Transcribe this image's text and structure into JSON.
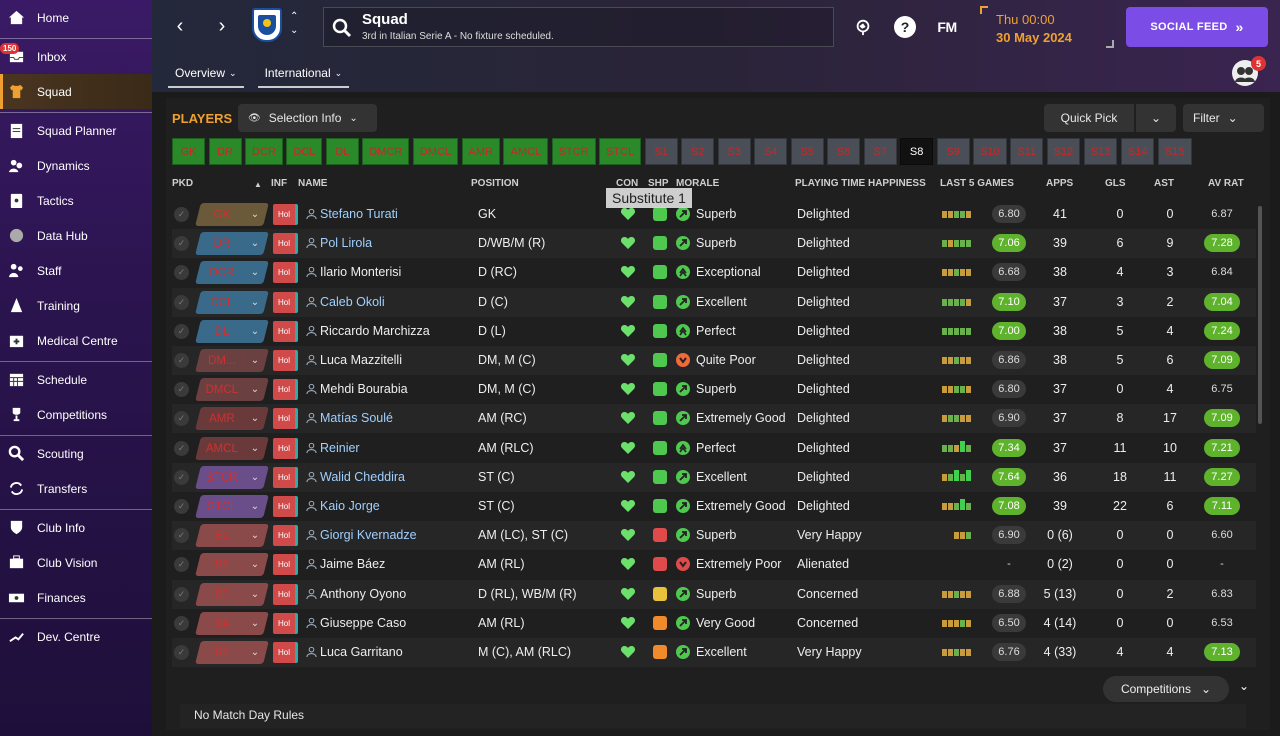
{
  "sidebar": {
    "items": [
      {
        "label": "Home",
        "icon": "home-icon"
      },
      {
        "label": "Inbox",
        "icon": "inbox-icon",
        "badge": "150"
      },
      {
        "label": "Squad",
        "icon": "shirt-icon",
        "active": true
      },
      {
        "label": "Squad Planner",
        "icon": "clipboard-icon"
      },
      {
        "label": "Dynamics",
        "icon": "people-icon"
      },
      {
        "label": "Tactics",
        "icon": "tactics-board-icon"
      },
      {
        "label": "Data Hub",
        "icon": "data-hub-icon"
      },
      {
        "label": "Staff",
        "icon": "staff-icon"
      },
      {
        "label": "Training",
        "icon": "training-cone-icon"
      },
      {
        "label": "Medical Centre",
        "icon": "medical-icon"
      },
      {
        "label": "Schedule",
        "icon": "calendar-icon"
      },
      {
        "label": "Competitions",
        "icon": "trophy-icon"
      },
      {
        "label": "Scouting",
        "icon": "magnifier-icon"
      },
      {
        "label": "Transfers",
        "icon": "transfer-arrows-icon"
      },
      {
        "label": "Club Info",
        "icon": "shield-icon"
      },
      {
        "label": "Club Vision",
        "icon": "briefcase-icon"
      },
      {
        "label": "Finances",
        "icon": "money-icon"
      },
      {
        "label": "Dev. Centre",
        "icon": "growth-icon"
      }
    ]
  },
  "header": {
    "title": "Squad",
    "subtitle": "3rd in Italian Serie A - No fixture scheduled.",
    "fm_label": "FM",
    "help_label": "?",
    "time": "Thu 00:00",
    "date": "30 May 2024",
    "social_feed": "SOCIAL FEED",
    "social_chevron": "»",
    "avatar_badge": "5",
    "tabs": [
      {
        "label": "Overview"
      },
      {
        "label": "International"
      }
    ]
  },
  "panel": {
    "title": "PLAYERS",
    "selection_info": "Selection Info",
    "quick_pick": "Quick Pick",
    "filter": "Filter",
    "tooltip": "Substitute 1",
    "competitions": "Competitions",
    "no_match_rules": "No Match Day Rules"
  },
  "selection_slots": [
    {
      "label": "GK",
      "state": "filled"
    },
    {
      "label": "DR",
      "state": "filled"
    },
    {
      "label": "DCR",
      "state": "filled"
    },
    {
      "label": "DCL",
      "state": "filled"
    },
    {
      "label": "DL",
      "state": "filled"
    },
    {
      "label": "DMCR",
      "state": "filled"
    },
    {
      "label": "DMCL",
      "state": "filled"
    },
    {
      "label": "AMR",
      "state": "filled"
    },
    {
      "label": "AMCL",
      "state": "filled"
    },
    {
      "label": "STCR",
      "state": "filled"
    },
    {
      "label": "STCL",
      "state": "filled"
    },
    {
      "label": "S1",
      "state": "empty"
    },
    {
      "label": "S2",
      "state": "empty"
    },
    {
      "label": "S3",
      "state": "empty"
    },
    {
      "label": "S4",
      "state": "empty"
    },
    {
      "label": "S5",
      "state": "empty"
    },
    {
      "label": "S6",
      "state": "empty"
    },
    {
      "label": "S7",
      "state": "empty"
    },
    {
      "label": "S8",
      "state": "current"
    },
    {
      "label": "S9",
      "state": "empty"
    },
    {
      "label": "S10",
      "state": "empty"
    },
    {
      "label": "S11",
      "state": "empty"
    },
    {
      "label": "S12",
      "state": "empty"
    },
    {
      "label": "S13",
      "state": "empty"
    },
    {
      "label": "S14",
      "state": "empty"
    },
    {
      "label": "S15",
      "state": "empty"
    }
  ],
  "table": {
    "headers": {
      "pkd": "PKD",
      "sort": "▲",
      "inf": "INF",
      "name": "NAME",
      "position": "POSITION",
      "con": "CON",
      "shp": "SHP",
      "morale": "MORALE",
      "pth": "PLAYING TIME HAPPINESS",
      "last5": "LAST 5 GAMES",
      "apps": "APPS",
      "gls": "GLS",
      "ast": "AST",
      "avrat": "AV RAT"
    },
    "rows": [
      {
        "pos": "GK",
        "inf": "Hol",
        "name": "Stefano Turati",
        "link": true,
        "position": "GK",
        "morale": "Superb",
        "mor": "up",
        "pth": "Delighted",
        "l5": "6.80",
        "l5g": false,
        "bars": "ccggc",
        "apps": "41",
        "gls": "0",
        "ast": "0",
        "avr": "6.87",
        "avrg": false,
        "shp": "g"
      },
      {
        "pos": "DR",
        "inf": "Hol",
        "name": "Pol Lirola",
        "link": true,
        "position": "D/WB/M (R)",
        "morale": "Superb",
        "mor": "up",
        "pth": "Delighted",
        "l5": "7.06",
        "l5g": true,
        "bars": "gcggg",
        "apps": "39",
        "gls": "6",
        "ast": "9",
        "avr": "7.28",
        "avrg": true,
        "shp": "g"
      },
      {
        "pos": "DCR",
        "inf": "Hol",
        "name": "Ilario Monterisi",
        "link": false,
        "position": "D (RC)",
        "morale": "Exceptional",
        "mor": "dbl",
        "pth": "Delighted",
        "l5": "6.68",
        "l5g": false,
        "bars": "ccgcc",
        "apps": "38",
        "gls": "4",
        "ast": "3",
        "avr": "6.84",
        "avrg": false,
        "shp": "g"
      },
      {
        "pos": "DCL",
        "inf": "Hol",
        "name": "Caleb Okoli",
        "link": true,
        "position": "D (C)",
        "morale": "Excellent",
        "mor": "up",
        "pth": "Delighted",
        "l5": "7.10",
        "l5g": true,
        "bars": "ggggc",
        "apps": "37",
        "gls": "3",
        "ast": "2",
        "avr": "7.04",
        "avrg": true,
        "shp": "g"
      },
      {
        "pos": "DL",
        "inf": "Hol",
        "name": "Riccardo Marchizza",
        "link": false,
        "position": "D (L)",
        "morale": "Perfect",
        "mor": "dbl",
        "pth": "Delighted",
        "l5": "7.00",
        "l5g": true,
        "bars": "ggggg",
        "apps": "38",
        "gls": "5",
        "ast": "4",
        "avr": "7.24",
        "avrg": true,
        "shp": "g"
      },
      {
        "pos": "DM...",
        "inf": "Hol",
        "name": "Luca Mazzitelli",
        "link": false,
        "position": "DM, M (C)",
        "morale": "Quite Poor",
        "mor": "down",
        "pth": "Delighted",
        "l5": "6.86",
        "l5g": false,
        "bars": "ccgcc",
        "apps": "38",
        "gls": "5",
        "ast": "6",
        "avr": "7.09",
        "avrg": true,
        "shp": "g"
      },
      {
        "pos": "DMCL",
        "inf": "Hol",
        "name": "Mehdi Bourabia",
        "link": false,
        "position": "DM, M (C)",
        "morale": "Superb",
        "mor": "up",
        "pth": "Delighted",
        "l5": "6.80",
        "l5g": false,
        "bars": "ccggc",
        "apps": "37",
        "gls": "0",
        "ast": "4",
        "avr": "6.75",
        "avrg": false,
        "shp": "g"
      },
      {
        "pos": "AMR",
        "inf": "Hol",
        "name": "Matías Soulé",
        "link": true,
        "position": "AM (RC)",
        "morale": "Extremely Good",
        "mor": "up",
        "pth": "Delighted",
        "l5": "6.90",
        "l5g": false,
        "bars": "cggcc",
        "apps": "37",
        "gls": "8",
        "ast": "17",
        "avr": "7.09",
        "avrg": true,
        "shp": "g"
      },
      {
        "pos": "AMCL",
        "inf": "Hol",
        "name": "Reinier",
        "link": true,
        "position": "AM (RLC)",
        "morale": "Perfect",
        "mor": "dbl",
        "pth": "Delighted",
        "l5": "7.34",
        "l5g": true,
        "bars": "ggcHg",
        "apps": "37",
        "gls": "11",
        "ast": "10",
        "avr": "7.21",
        "avrg": true,
        "shp": "g"
      },
      {
        "pos": "STCR",
        "inf": "Hol",
        "name": "Walid Cheddira",
        "link": true,
        "position": "ST (C)",
        "morale": "Excellent",
        "mor": "up",
        "pth": "Delighted",
        "l5": "7.64",
        "l5g": true,
        "bars": "cgHgH",
        "apps": "36",
        "gls": "18",
        "ast": "11",
        "avr": "7.27",
        "avrg": true,
        "shp": "g"
      },
      {
        "pos": "STCL",
        "inf": "Hol",
        "name": "Kaio Jorge",
        "link": true,
        "position": "ST (C)",
        "morale": "Extremely Good",
        "mor": "up",
        "pth": "Delighted",
        "l5": "7.08",
        "l5g": true,
        "bars": "ccgHg",
        "apps": "39",
        "gls": "22",
        "ast": "6",
        "avr": "7.11",
        "avrg": true,
        "shp": "g"
      },
      {
        "pos": "S1",
        "inf": "Hol",
        "name": "Giorgi Kvernadze",
        "link": true,
        "position": "AM (LC), ST (C)",
        "morale": "Superb",
        "mor": "up",
        "pth": "Very Happy",
        "l5": "6.90",
        "l5g": false,
        "bars": "  ccg",
        "apps": "0 (6)",
        "gls": "0",
        "ast": "0",
        "avr": "6.60",
        "avrg": false,
        "shp": "r"
      },
      {
        "pos": "S2",
        "inf": "Hol",
        "name": "Jaime Báez",
        "link": false,
        "position": "AM (RL)",
        "morale": "Extremely Poor",
        "mor": "down",
        "pth": "Alienated",
        "l5": "-",
        "l5g": false,
        "bars": "     ",
        "apps": "0 (2)",
        "gls": "0",
        "ast": "0",
        "avr": "-",
        "avrg": false,
        "shp": "r"
      },
      {
        "pos": "S3",
        "inf": "Hol",
        "name": "Anthony Oyono",
        "link": false,
        "position": "D (RL), WB/M (R)",
        "morale": "Superb",
        "mor": "up",
        "pth": "Concerned",
        "l5": "6.88",
        "l5g": false,
        "bars": "ccgcc",
        "apps": "5 (13)",
        "gls": "0",
        "ast": "2",
        "avr": "6.83",
        "avrg": false,
        "shp": "y"
      },
      {
        "pos": "S4",
        "inf": "Hol",
        "name": "Giuseppe Caso",
        "link": false,
        "position": "AM (RL)",
        "morale": "Very Good",
        "mor": "up",
        "pth": "Concerned",
        "l5": "6.50",
        "l5g": false,
        "bars": "cccgc",
        "apps": "4 (14)",
        "gls": "0",
        "ast": "0",
        "avr": "6.53",
        "avrg": false,
        "shp": "o"
      },
      {
        "pos": "S5",
        "inf": "Hol",
        "name": "Luca Garritano",
        "link": false,
        "position": "M (C), AM (RLC)",
        "morale": "Excellent",
        "mor": "up",
        "pth": "Very Happy",
        "l5": "6.76",
        "l5g": false,
        "bars": "ccgcc",
        "apps": "4 (33)",
        "gls": "4",
        "ast": "4",
        "avr": "7.13",
        "avrg": true,
        "shp": "o"
      }
    ]
  }
}
